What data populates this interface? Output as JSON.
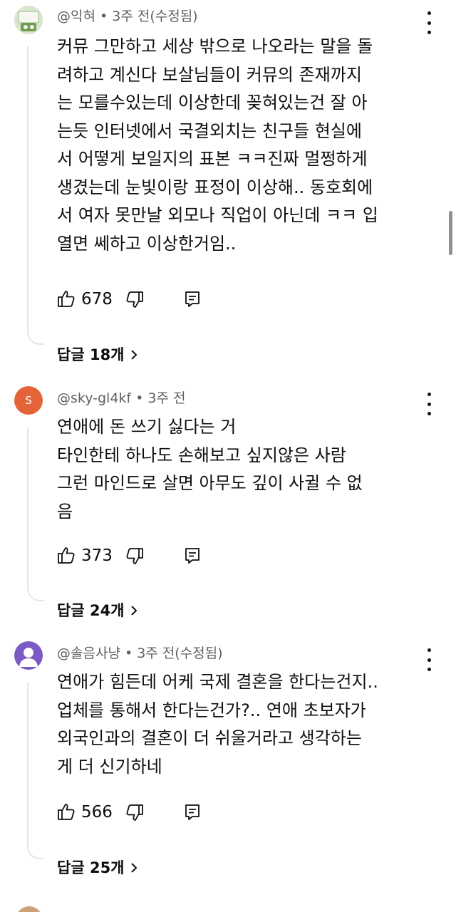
{
  "comments": [
    {
      "author": "@익혀",
      "meta": "@익혀 • 3주 전(수정됨)",
      "avatar_letter": "",
      "body_lines": [
        "커뮤 그만하고 세상 밖으로 나오라는 말을 돌",
        "려하고 계신다 보살님들이 커뮤의 존재까지",
        "는 모를수있는데 이상한데 꽂혀있는건 잘 아",
        "는듯 인터넷에서 국결외치는 친구들 현실에",
        "서 어떻게 보일지의 표본 ㅋㅋ진짜 멀쩡하게",
        "생겼는데 눈빛이랑 표정이 이상해.. 동호회에",
        "서 여자 못만날 외모나 직업이 아닌데 ㅋㅋ 입",
        "열면 쎄하고 이상한거임.."
      ],
      "likes": "678",
      "replies_label": "답글 18개"
    },
    {
      "author": "@sky-gl4kf",
      "meta": "@sky-gl4kf • 3주 전",
      "avatar_letter": "S",
      "body_lines": [
        "연애에 돈 쓰기 싫다는 거",
        "타인한테 하나도 손해보고 싶지않은 사람",
        "그런 마인드로 살면  아무도 깊이 사귈 수 없",
        "음"
      ],
      "likes": "373",
      "replies_label": "답글 24개"
    },
    {
      "author": "@솔음사냥",
      "meta": "@솔음사냥 • 3주 전(수정됨)",
      "avatar_letter": "",
      "body_lines": [
        "연애가 힘든데 어케 국제 결혼을 한다는건지..",
        "업체를 통해서 한다는건가?.. 연애 초보자가",
        "외국인과의 결혼이 더 쉬울거라고 생각하는",
        "게 더 신기하네"
      ],
      "likes": "566",
      "replies_label": "답글 25개"
    }
  ],
  "icons": {
    "like": "thumbs-up-icon",
    "dislike": "thumbs-down-icon",
    "reply": "reply-icon",
    "more": "more-vert-icon",
    "expand": "chevron-right-icon"
  },
  "colors": {
    "text": "#0f0f0f",
    "meta": "#606060",
    "avatar_s": "#e4643a",
    "avatar_purple": "#7a5ac4"
  }
}
